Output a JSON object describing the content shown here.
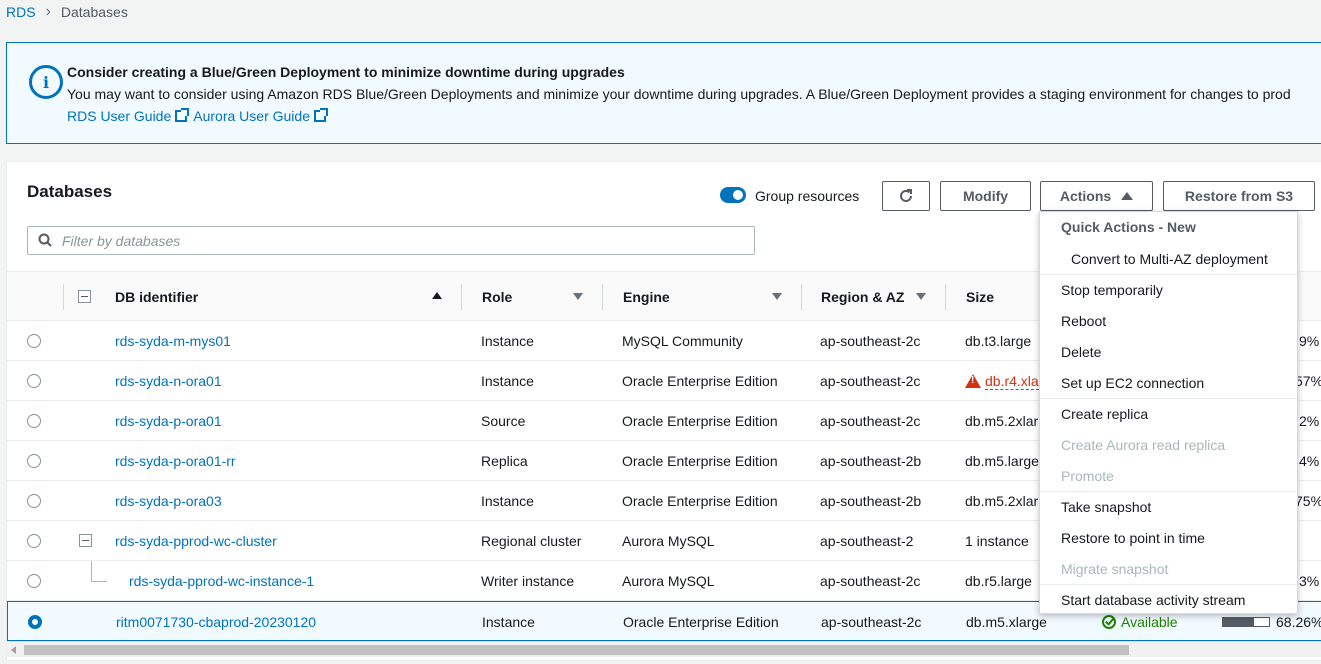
{
  "breadcrumb": {
    "root": "RDS",
    "current": "Databases"
  },
  "alert": {
    "title": "Consider creating a Blue/Green Deployment to minimize downtime during upgrades",
    "body": "You may want to consider using Amazon RDS Blue/Green Deployments and minimize your downtime during upgrades. A Blue/Green Deployment provides a staging environment for changes to prod",
    "link1": "RDS User Guide",
    "link2": "Aurora User Guide"
  },
  "panel": {
    "title": "Databases",
    "toggle_label": "Group resources",
    "modify_label": "Modify",
    "actions_label": "Actions",
    "restore_label": "Restore from S3",
    "search_placeholder": "Filter by databases"
  },
  "columns": {
    "db_identifier": "DB identifier",
    "role": "Role",
    "engine": "Engine",
    "region": "Region & AZ",
    "size": "Size"
  },
  "rows": [
    {
      "id": "rds-syda-m-mys01",
      "role": "Instance",
      "engine": "MySQL Community",
      "region": "ap-southeast-2c",
      "size": "db.t3.large",
      "cpu": "9%"
    },
    {
      "id": "rds-syda-n-ora01",
      "role": "Instance",
      "engine": "Oracle Enterprise Edition",
      "region": "ap-southeast-2c",
      "size": "db.r4.xla",
      "cpu": "57%"
    },
    {
      "id": "rds-syda-p-ora01",
      "role": "Source",
      "engine": "Oracle Enterprise Edition",
      "region": "ap-southeast-2c",
      "size": "db.m5.2xlar",
      "cpu": "2%"
    },
    {
      "id": "rds-syda-p-ora01-rr",
      "role": "Replica",
      "engine": "Oracle Enterprise Edition",
      "region": "ap-southeast-2b",
      "size": "db.m5.large",
      "cpu": "4%"
    },
    {
      "id": "rds-syda-p-ora03",
      "role": "Instance",
      "engine": "Oracle Enterprise Edition",
      "region": "ap-southeast-2b",
      "size": "db.m5.2xlar",
      "cpu": "75%"
    },
    {
      "id": "rds-syda-pprod-wc-cluster",
      "role": "Regional cluster",
      "engine": "Aurora MySQL",
      "region": "ap-southeast-2",
      "size": "1 instance",
      "cpu": ""
    },
    {
      "id": "rds-syda-pprod-wc-instance-1",
      "role": "Writer instance",
      "engine": "Aurora MySQL",
      "region": "ap-southeast-2c",
      "size": "db.r5.large",
      "cpu": "3%"
    },
    {
      "id": "ritm0071730-cbaprod-20230120",
      "role": "Instance",
      "engine": "Oracle Enterprise Edition",
      "region": "ap-southeast-2c",
      "size": "db.m5.xlarge",
      "status": "Available",
      "cpu": "68.26%",
      "cpu_fraction": 0.6826
    }
  ],
  "menu": {
    "header": "Quick Actions - New",
    "convert": "Convert to Multi-AZ deployment",
    "stop": "Stop temporarily",
    "reboot": "Reboot",
    "delete": "Delete",
    "ec2": "Set up EC2 connection",
    "create_replica": "Create replica",
    "aurora_replica": "Create Aurora read replica",
    "promote": "Promote",
    "snapshot": "Take snapshot",
    "restore_pit": "Restore to point in time",
    "migrate": "Migrate snapshot",
    "activity": "Start database activity stream"
  }
}
